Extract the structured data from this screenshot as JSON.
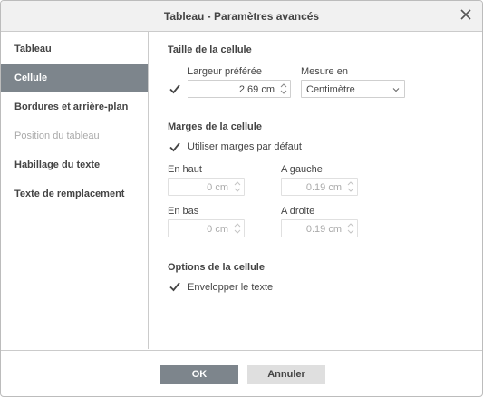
{
  "dialog": {
    "title": "Tableau - Paramètres avancés"
  },
  "sidebar": {
    "items": [
      {
        "label": "Tableau"
      },
      {
        "label": "Cellule"
      },
      {
        "label": "Bordures et arrière-plan"
      },
      {
        "label": "Position du tableau"
      },
      {
        "label": "Habillage du texte"
      },
      {
        "label": "Texte de remplacement"
      }
    ]
  },
  "cell_size": {
    "heading": "Taille de la cellule",
    "preferred_width_label": "Largeur préférée",
    "preferred_width_value": "2.69 cm",
    "measure_label": "Mesure en",
    "measure_value": "Centimètre"
  },
  "margins": {
    "heading": "Marges de la cellule",
    "default_label": "Utiliser marges par défaut",
    "top_label": "En haut",
    "top_value": "0 cm",
    "left_label": "A gauche",
    "left_value": "0.19 cm",
    "bottom_label": "En bas",
    "bottom_value": "0 cm",
    "right_label": "A droite",
    "right_value": "0.19 cm"
  },
  "options": {
    "heading": "Options de la cellule",
    "wrap_label": "Envelopper le texte"
  },
  "footer": {
    "ok_label": "OK",
    "cancel_label": "Annuler"
  }
}
